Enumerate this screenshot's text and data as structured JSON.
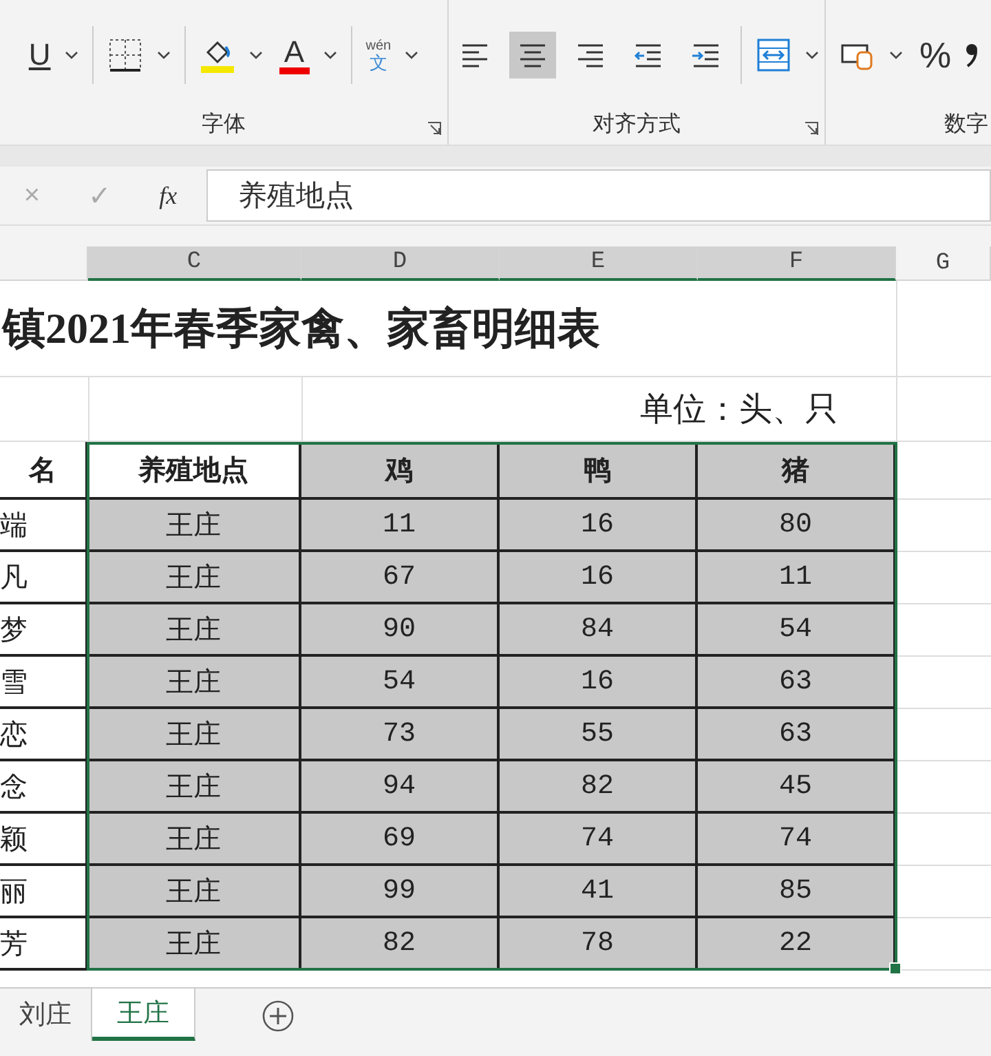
{
  "ribbon": {
    "font_group": {
      "underline": "U",
      "font_color": "A",
      "phonetic_top": "wén",
      "phonetic_bottom": "文",
      "label": "字体"
    },
    "align_group": {
      "buttons": [
        {
          "kind": "left",
          "selected": false
        },
        {
          "kind": "center",
          "selected": true
        },
        {
          "kind": "right",
          "selected": false
        },
        {
          "kind": "outdent",
          "selected": false
        },
        {
          "kind": "indent",
          "selected": false
        }
      ],
      "label": "对齐方式"
    },
    "number_group": {
      "percent": "%",
      "label": "数字"
    }
  },
  "formula_bar": {
    "cancel": "×",
    "enter": "✓",
    "fx": "fx",
    "value": "养殖地点"
  },
  "columns": [
    {
      "label": "C",
      "selected": true
    },
    {
      "label": "D",
      "selected": true
    },
    {
      "label": "E",
      "selected": true
    },
    {
      "label": "F",
      "selected": true
    },
    {
      "label": "G",
      "selected": false
    }
  ],
  "title": "镇2021年春季家禽、家畜明细表",
  "unit": "单位：头、只",
  "table": {
    "name_header": "名",
    "header": [
      {
        "text": "养殖地点",
        "active": true
      },
      {
        "text": "鸡",
        "active": false
      },
      {
        "text": "鸭",
        "active": false
      },
      {
        "text": "猪",
        "active": false
      }
    ],
    "rows": [
      {
        "name": "端",
        "cells": [
          "王庄",
          "11",
          "16",
          "80"
        ]
      },
      {
        "name": "凡",
        "cells": [
          "王庄",
          "67",
          "16",
          "11"
        ]
      },
      {
        "name": "梦",
        "cells": [
          "王庄",
          "90",
          "84",
          "54"
        ]
      },
      {
        "name": "雪",
        "cells": [
          "王庄",
          "54",
          "16",
          "63"
        ]
      },
      {
        "name": "恋",
        "cells": [
          "王庄",
          "73",
          "55",
          "63"
        ]
      },
      {
        "name": "念",
        "cells": [
          "王庄",
          "94",
          "82",
          "45"
        ]
      },
      {
        "name": "颖",
        "cells": [
          "王庄",
          "69",
          "74",
          "74"
        ]
      },
      {
        "name": "丽",
        "cells": [
          "王庄",
          "99",
          "41",
          "85"
        ]
      },
      {
        "name": "芳",
        "cells": [
          "王庄",
          "82",
          "78",
          "22"
        ]
      }
    ]
  },
  "sheet_tabs": [
    {
      "label": "刘庄",
      "selected": false
    },
    {
      "label": "王庄",
      "selected": true
    }
  ]
}
